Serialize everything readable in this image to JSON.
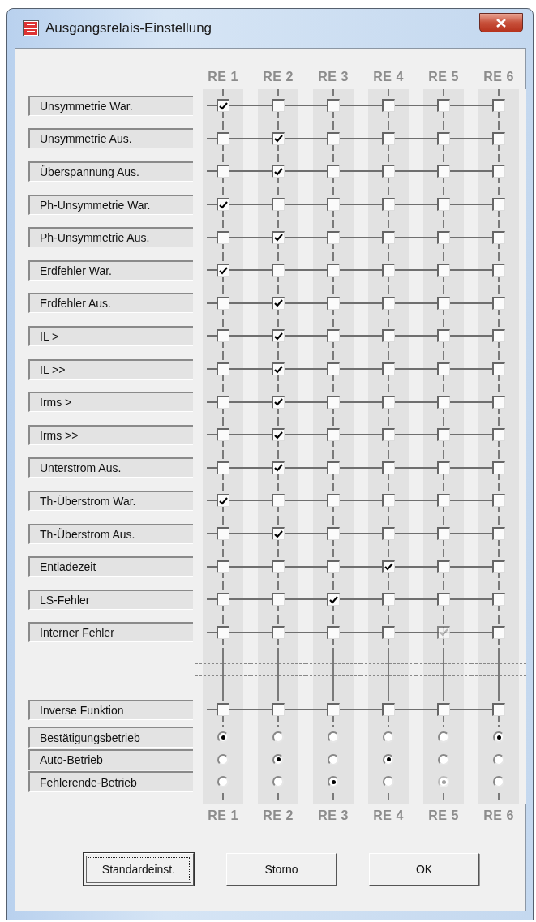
{
  "window": {
    "title": "Ausgangsrelais-Einstellung"
  },
  "relays_top": [
    "RE 1",
    "RE 2",
    "RE 3",
    "RE 4",
    "RE 5",
    "RE 6"
  ],
  "check_rows": [
    {
      "label": "Unsymmetrie War.",
      "checked": [
        true,
        false,
        false,
        false,
        false,
        false
      ],
      "disabled": [
        false,
        false,
        false,
        false,
        false,
        false
      ]
    },
    {
      "label": "Unsymmetrie Aus.",
      "checked": [
        false,
        true,
        false,
        false,
        false,
        false
      ],
      "disabled": [
        false,
        false,
        false,
        false,
        false,
        false
      ]
    },
    {
      "label": "Überspannung Aus.",
      "checked": [
        false,
        true,
        false,
        false,
        false,
        false
      ],
      "disabled": [
        false,
        false,
        false,
        false,
        false,
        false
      ]
    },
    {
      "label": "Ph-Unsymmetrie War.",
      "checked": [
        true,
        false,
        false,
        false,
        false,
        false
      ],
      "disabled": [
        false,
        false,
        false,
        false,
        false,
        false
      ]
    },
    {
      "label": "Ph-Unsymmetrie Aus.",
      "checked": [
        false,
        true,
        false,
        false,
        false,
        false
      ],
      "disabled": [
        false,
        false,
        false,
        false,
        false,
        false
      ]
    },
    {
      "label": "Erdfehler War.",
      "checked": [
        true,
        false,
        false,
        false,
        false,
        false
      ],
      "disabled": [
        false,
        false,
        false,
        false,
        false,
        false
      ]
    },
    {
      "label": "Erdfehler Aus.",
      "checked": [
        false,
        true,
        false,
        false,
        false,
        false
      ],
      "disabled": [
        false,
        false,
        false,
        false,
        false,
        false
      ]
    },
    {
      "label": "IL >",
      "checked": [
        false,
        true,
        false,
        false,
        false,
        false
      ],
      "disabled": [
        false,
        false,
        false,
        false,
        false,
        false
      ]
    },
    {
      "label": "IL >>",
      "checked": [
        false,
        true,
        false,
        false,
        false,
        false
      ],
      "disabled": [
        false,
        false,
        false,
        false,
        false,
        false
      ]
    },
    {
      "label": "Irms >",
      "checked": [
        false,
        true,
        false,
        false,
        false,
        false
      ],
      "disabled": [
        false,
        false,
        false,
        false,
        false,
        false
      ]
    },
    {
      "label": "Irms >>",
      "checked": [
        false,
        true,
        false,
        false,
        false,
        false
      ],
      "disabled": [
        false,
        false,
        false,
        false,
        false,
        false
      ]
    },
    {
      "label": "Unterstrom Aus.",
      "checked": [
        false,
        true,
        false,
        false,
        false,
        false
      ],
      "disabled": [
        false,
        false,
        false,
        false,
        false,
        false
      ]
    },
    {
      "label": "Th-Überstrom War.",
      "checked": [
        true,
        false,
        false,
        false,
        false,
        false
      ],
      "disabled": [
        false,
        false,
        false,
        false,
        false,
        false
      ]
    },
    {
      "label": "Th-Überstrom Aus.",
      "checked": [
        false,
        true,
        false,
        false,
        false,
        false
      ],
      "disabled": [
        false,
        false,
        false,
        false,
        false,
        false
      ]
    },
    {
      "label": "Entladezeit",
      "checked": [
        false,
        false,
        false,
        true,
        false,
        false
      ],
      "disabled": [
        false,
        false,
        false,
        false,
        false,
        false
      ]
    },
    {
      "label": "LS-Fehler",
      "checked": [
        false,
        false,
        true,
        false,
        false,
        false
      ],
      "disabled": [
        false,
        false,
        false,
        false,
        false,
        false
      ]
    },
    {
      "label": "Interner Fehler",
      "checked": [
        false,
        false,
        false,
        false,
        true,
        false
      ],
      "disabled": [
        false,
        false,
        false,
        false,
        true,
        false
      ]
    }
  ],
  "inverse_row": {
    "label": "Inverse Funktion",
    "checked": [
      false,
      false,
      false,
      false,
      false,
      false
    ],
    "disabled": [
      false,
      false,
      false,
      false,
      false,
      false
    ]
  },
  "mode_rows": [
    {
      "label": "Bestätigungsbetrieb",
      "selected": [
        true,
        false,
        false,
        false,
        false,
        true
      ],
      "disabled": [
        false,
        false,
        false,
        false,
        false,
        false
      ]
    },
    {
      "label": "Auto-Betrieb",
      "selected": [
        false,
        true,
        false,
        true,
        false,
        false
      ],
      "disabled": [
        false,
        false,
        false,
        false,
        false,
        false
      ]
    },
    {
      "label": "Fehlerende-Betrieb",
      "selected": [
        false,
        false,
        true,
        false,
        true,
        false
      ],
      "disabled": [
        false,
        false,
        false,
        false,
        true,
        false
      ]
    }
  ],
  "relays_bottom": [
    "RE 1",
    "RE 2",
    "RE 3",
    "RE 4",
    "RE 5",
    "RE 6"
  ],
  "buttons": [
    {
      "label": "Standardeinst.",
      "focused": true
    },
    {
      "label": "Storno",
      "focused": false
    },
    {
      "label": "OK",
      "focused": false
    }
  ]
}
